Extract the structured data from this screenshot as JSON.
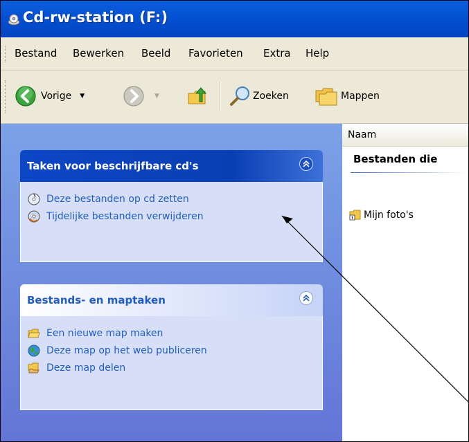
{
  "window": {
    "title": "Cd-rw-station (F:)"
  },
  "menu": {
    "items": [
      "Bestand",
      "Bewerken",
      "Beeld",
      "Favorieten",
      "Extra",
      "Help"
    ]
  },
  "toolbar": {
    "back_label": "Vorige",
    "search_label": "Zoeken",
    "folders_label": "Mappen"
  },
  "taskpane": {
    "cd_tasks": {
      "title": "Taken voor beschrijfbare cd's",
      "items": [
        {
          "label": "Deze bestanden op cd zetten",
          "icon": "cd-write-icon"
        },
        {
          "label": "Tijdelijke bestanden verwijderen",
          "icon": "cd-delete-icon"
        }
      ]
    },
    "file_tasks": {
      "title": "Bestands- en maptaken",
      "items": [
        {
          "label": "Een nieuwe map maken",
          "icon": "new-folder-icon"
        },
        {
          "label": "Deze map op het web publiceren",
          "icon": "publish-web-icon"
        },
        {
          "label": "Deze map delen",
          "icon": "share-folder-icon"
        }
      ]
    }
  },
  "filepane": {
    "column_header": "Naam",
    "group_header": "Bestanden die",
    "items": [
      {
        "label": "Mijn foto's",
        "icon": "folder-pending-icon"
      }
    ]
  },
  "colors": {
    "titlebar": "#0250d2",
    "pane_bg": "#7ba2e7",
    "special_header": "#0c47c6",
    "link": "#215dc6"
  }
}
